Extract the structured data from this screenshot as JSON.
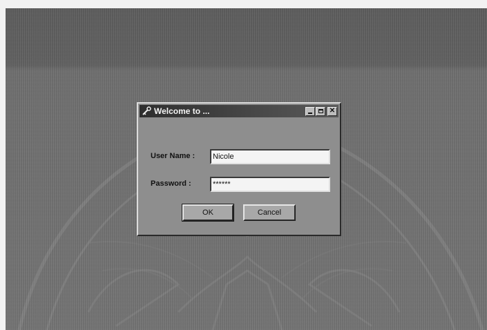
{
  "dialog": {
    "title": "Welcome to ...",
    "username_label": "User Name :",
    "username_value": "Nicole",
    "password_label": "Password :",
    "password_value": "******",
    "ok_label": "OK",
    "cancel_label": "Cancel"
  },
  "icons": {
    "title": "key-icon",
    "minimize": "minimize-icon",
    "maximize": "maximize-icon",
    "close": "close-icon"
  }
}
